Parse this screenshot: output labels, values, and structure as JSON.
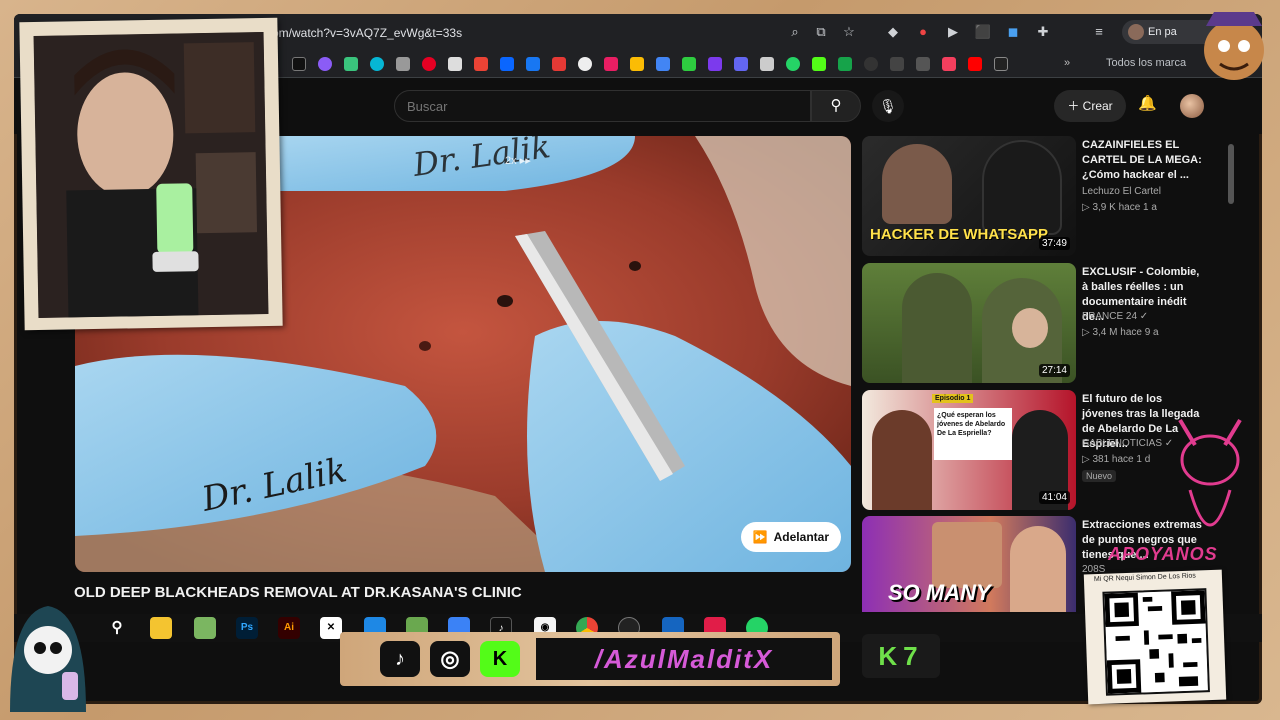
{
  "browser": {
    "url": "om/watch?v=3vAQ7Z_evWg&t=33s",
    "profile_label": "En pa",
    "bookmarks_folder": "Todos los marca"
  },
  "youtube": {
    "search_placeholder": "Buscar",
    "create_label": "Crear"
  },
  "video": {
    "speed_badge": "2x",
    "watermark": "Dr. Lalik",
    "skip_label": "Adelantar",
    "title": "OLD DEEP BLACKHEADS REMOVAL AT DR.KASANA'S CLINIC"
  },
  "recommendations": [
    {
      "title": "CAZAINFIELES EL CARTEL DE LA MEGA: ¿Cómo hackear el ...",
      "channel": "Lechuzo El Cartel",
      "meta": "▷ 3,9 K  hace 1 a",
      "duration": "37:49",
      "thumb_text": "HACKER DE WHATSAPP"
    },
    {
      "title": "EXCLUSIF - Colombie, à balles réelles : un documentaire inédit de...",
      "channel": "FRANCE 24 ✓",
      "meta": "▷ 3,4 M  hace 9 a",
      "duration": "27:14"
    },
    {
      "title": "El futuro de los jóvenes tras la llegada de Abelardo De La Espriel...",
      "channel": "CABLENOTICIAS ✓",
      "meta": "▷ 381  hace 1 d",
      "badge": "Nuevo",
      "duration": "41:04",
      "thumb_text": "¿Qué esperan los jóvenes de Abelardo De La Espriella?",
      "thumb_tag": "Episodio 1"
    },
    {
      "title": "Extracciones extremas de puntos negros que tienes que ...",
      "channel": "208S",
      "meta": "",
      "thumb_text": "SO MANY"
    }
  ],
  "social": {
    "handle": "/AzulMalditX",
    "k7": "K7",
    "apoyanos": "APOYANOS",
    "qr_label": "Mi QR Nequi Simon De Los Rios"
  },
  "colors": {
    "youtube_bg": "#0f0f0f",
    "chrome_bg": "#202124",
    "handle_pink": "#d65ad8",
    "k7_green": "#6fe04a",
    "frame_tan": "#c9a27a"
  }
}
